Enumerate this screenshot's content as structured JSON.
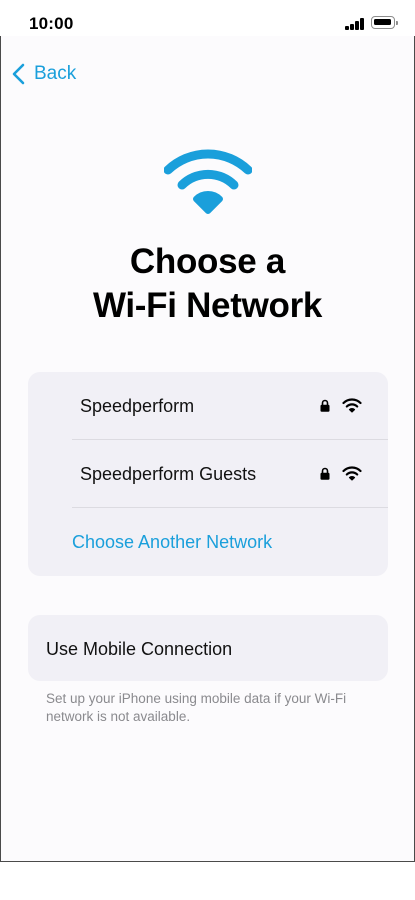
{
  "status_bar": {
    "time": "10:00",
    "icons": [
      "signal-icon",
      "battery-icon"
    ]
  },
  "nav": {
    "back_label": "Back"
  },
  "header": {
    "title_line1": "Choose a",
    "title_line2": "Wi-Fi Network",
    "hero_icon": "wifi-icon"
  },
  "networks": [
    {
      "name": "Speedperform",
      "secured": true,
      "icons": [
        "lock-icon",
        "wifi-icon"
      ]
    },
    {
      "name": "Speedperform Guests",
      "secured": true,
      "icons": [
        "lock-icon",
        "wifi-icon"
      ]
    }
  ],
  "choose_another_label": "Choose Another Network",
  "mobile": {
    "label": "Use Mobile Connection",
    "caption": "Set up your iPhone using mobile data if your Wi-Fi network is not available."
  },
  "colors": {
    "accent": "#1a9fdb",
    "card_bg": "#f1f0f6",
    "page_bg": "#fcfbfd",
    "caption": "#8a8a8e"
  }
}
